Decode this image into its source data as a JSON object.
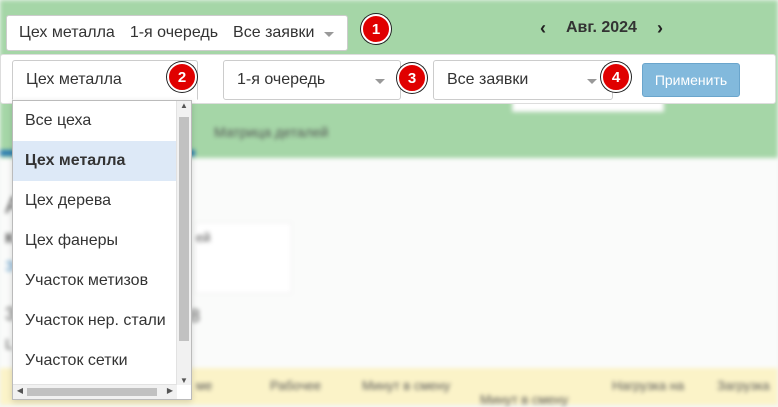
{
  "top_bar": {
    "workshop": "Цех металла",
    "queue": "1-я очередь",
    "requests": "Все заявки"
  },
  "month_nav": {
    "prev_icon": "chevron-left-icon",
    "next_icon": "chevron-right-icon",
    "label": "Авг. 2024"
  },
  "filters": {
    "workshop_value": "Цех металла",
    "queue_value": "1-я очередь",
    "requests_value": "Все заявки",
    "apply_label": "Применить"
  },
  "badges": [
    "1",
    "2",
    "3",
    "4"
  ],
  "workshop_dropdown": {
    "options": [
      "Все цеха",
      "Цех металла",
      "Цех дерева",
      "Цех фанеры",
      "Участок метизов",
      "Участок нер. стали",
      "Участок сетки"
    ],
    "selected": "Цех металла"
  },
  "background": {
    "tab_label": "Матрица деталей",
    "left_letter": "А",
    "left_bold": "К",
    "left_link": "З",
    "left_num": "3",
    "left_l": "L",
    "mid_fragment_1": "ей",
    "mid_fragment_2": "8",
    "table_headers": [
      "ме",
      "Рабочее",
      "Минут в смену",
      "Минут в смену",
      "Нагрузка на",
      "Загрузка"
    ]
  },
  "colors": {
    "badge": "#e00000",
    "selected_option": "#dde9f7",
    "apply_button": "#82b9dc",
    "header_bg": "#a5d6a7"
  }
}
